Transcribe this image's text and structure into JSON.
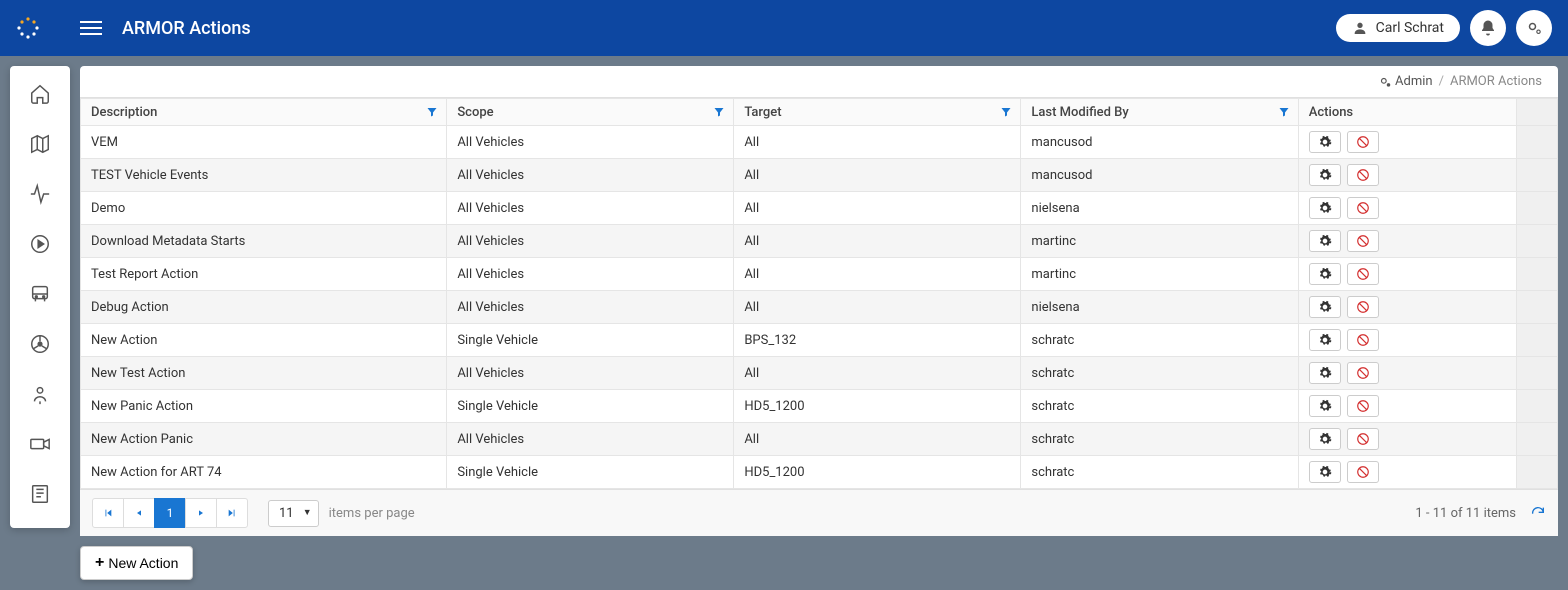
{
  "header": {
    "title": "ARMOR Actions",
    "user_name": "Carl Schrat"
  },
  "breadcrumb": {
    "admin_label": "Admin",
    "current": "ARMOR Actions"
  },
  "columns": {
    "description": "Description",
    "scope": "Scope",
    "target": "Target",
    "last_modified_by": "Last Modified By",
    "actions": "Actions"
  },
  "rows": [
    {
      "description": "VEM",
      "scope": "All Vehicles",
      "target": "All",
      "modified_by": "mancusod"
    },
    {
      "description": "TEST Vehicle Events",
      "scope": "All Vehicles",
      "target": "All",
      "modified_by": "mancusod"
    },
    {
      "description": "Demo",
      "scope": "All Vehicles",
      "target": "All",
      "modified_by": "nielsena"
    },
    {
      "description": "Download Metadata Starts",
      "scope": "All Vehicles",
      "target": "All",
      "modified_by": "martinc"
    },
    {
      "description": "Test Report Action",
      "scope": "All Vehicles",
      "target": "All",
      "modified_by": "martinc"
    },
    {
      "description": "Debug Action",
      "scope": "All Vehicles",
      "target": "All",
      "modified_by": "nielsena"
    },
    {
      "description": "New Action",
      "scope": "Single Vehicle",
      "target": "BPS_132",
      "modified_by": "schratc"
    },
    {
      "description": "New Test Action",
      "scope": "All Vehicles",
      "target": "All",
      "modified_by": "schratc"
    },
    {
      "description": "New Panic Action",
      "scope": "Single Vehicle",
      "target": "HD5_1200",
      "modified_by": "schratc"
    },
    {
      "description": "New Action Panic",
      "scope": "All Vehicles",
      "target": "All",
      "modified_by": "schratc"
    },
    {
      "description": "New Action for ART 74",
      "scope": "Single Vehicle",
      "target": "HD5_1200",
      "modified_by": "schratc"
    }
  ],
  "pager": {
    "current_page": "1",
    "page_size": "11",
    "items_per_page_label": "items per page",
    "summary": "1 - 11 of 11 items"
  },
  "buttons": {
    "new_action": "New Action"
  }
}
